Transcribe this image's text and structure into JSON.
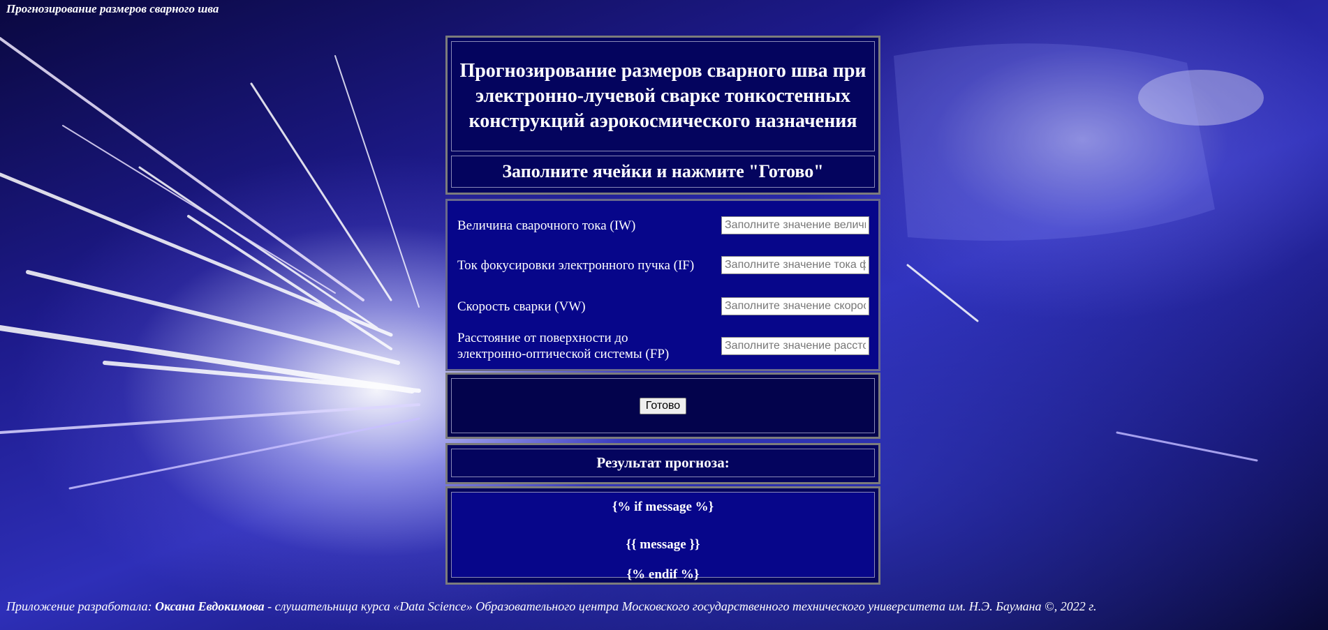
{
  "page": {
    "top_title": "Прогнозирование размеров сварного шва"
  },
  "header": {
    "title": "Прогнозирование размеров сварного шва при электронно-лучевой сварке тонкостенных конструкций аэрокосмического назначения",
    "instruction": "Заполните ячейки и нажмите \"Готово\""
  },
  "form": {
    "fields": [
      {
        "label": "Величина сварочного тока (IW)",
        "placeholder": "Заполните значение величины сварочного тока",
        "value": ""
      },
      {
        "label": "Ток фокусировки электронного пучка (IF)",
        "placeholder": "Заполните значение тока фокусировки",
        "value": ""
      },
      {
        "label": "Скорость сварки (VW)",
        "placeholder": "Заполните значение скорости сварки",
        "value": ""
      },
      {
        "label": "Расстояние от поверхности до электронно-оптической системы (FP)",
        "placeholder": "Заполните значение расстояния",
        "value": ""
      }
    ],
    "submit_label": "Готово"
  },
  "result": {
    "title": "Результат прогноза:",
    "lines": [
      "{% if message %}",
      "{{ message }}",
      "{% endif %}"
    ]
  },
  "footer": {
    "prefix": "Приложение разработала: ",
    "author": "Оксана Евдокимова",
    "suffix": " -  слушательница курса «Data Science» Образовательного центра Московского государственного технического университета им. Н.Э. Баумана ©, 2022 г."
  },
  "colors": {
    "panel_dark": "#04045e",
    "panel_blue": "#07068a",
    "border_gray": "#7c7c7c"
  }
}
